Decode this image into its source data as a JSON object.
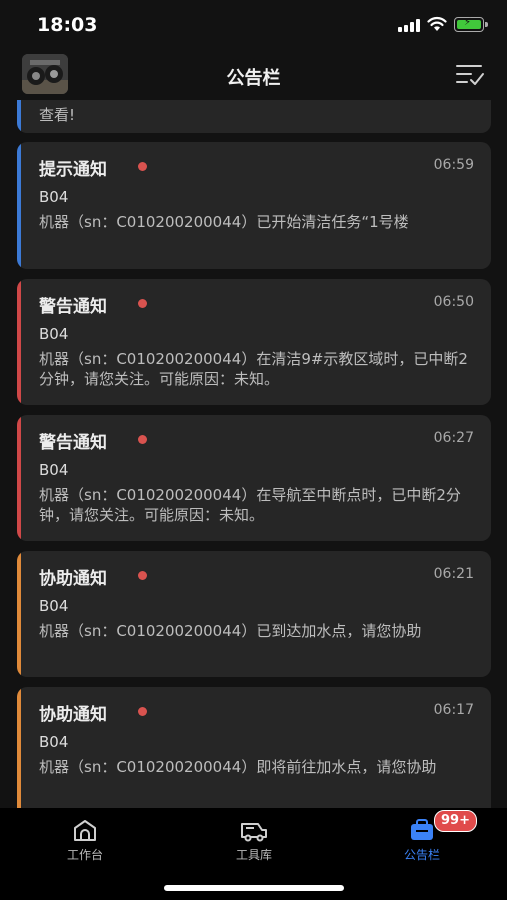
{
  "status_bar": {
    "time": "18:03"
  },
  "header": {
    "title": "公告栏"
  },
  "partial_card": {
    "text": "查看!"
  },
  "notifications": [
    {
      "title": "提示通知",
      "time": "06:59",
      "device": "B04",
      "message": "机器（sn：C010200200044）已开始清洁任务“1号楼",
      "accent": "#3c7ad6"
    },
    {
      "title": "警告通知",
      "time": "06:50",
      "device": "B04",
      "message": "机器（sn：C010200200044）在清洁9#示教区域时，已中断2分钟，请您关注。可能原因：未知。",
      "accent": "#d04848"
    },
    {
      "title": "警告通知",
      "time": "06:27",
      "device": "B04",
      "message": "机器（sn：C010200200044）在导航至中断点时，已中断2分钟，请您关注。可能原因：未知。",
      "accent": "#d04848"
    },
    {
      "title": "协助通知",
      "time": "06:21",
      "device": "B04",
      "message": "机器（sn：C010200200044）已到达加水点，请您协助",
      "accent": "#e08a3a"
    },
    {
      "title": "协助通知",
      "time": "06:17",
      "device": "B04",
      "message": "机器（sn：C010200200044）即将前往加水点，请您协助",
      "accent": "#e08a3a"
    }
  ],
  "tabs": [
    {
      "label": "工作台",
      "icon": "home-icon"
    },
    {
      "label": "工具库",
      "icon": "robot-cart-icon"
    },
    {
      "label": "公告栏",
      "icon": "notice-board-icon",
      "active": true
    }
  ],
  "badge": "99+",
  "colors": {
    "active_tab": "#3b82f6",
    "badge": "#e04b4b",
    "unread_dot": "#d9534f"
  }
}
